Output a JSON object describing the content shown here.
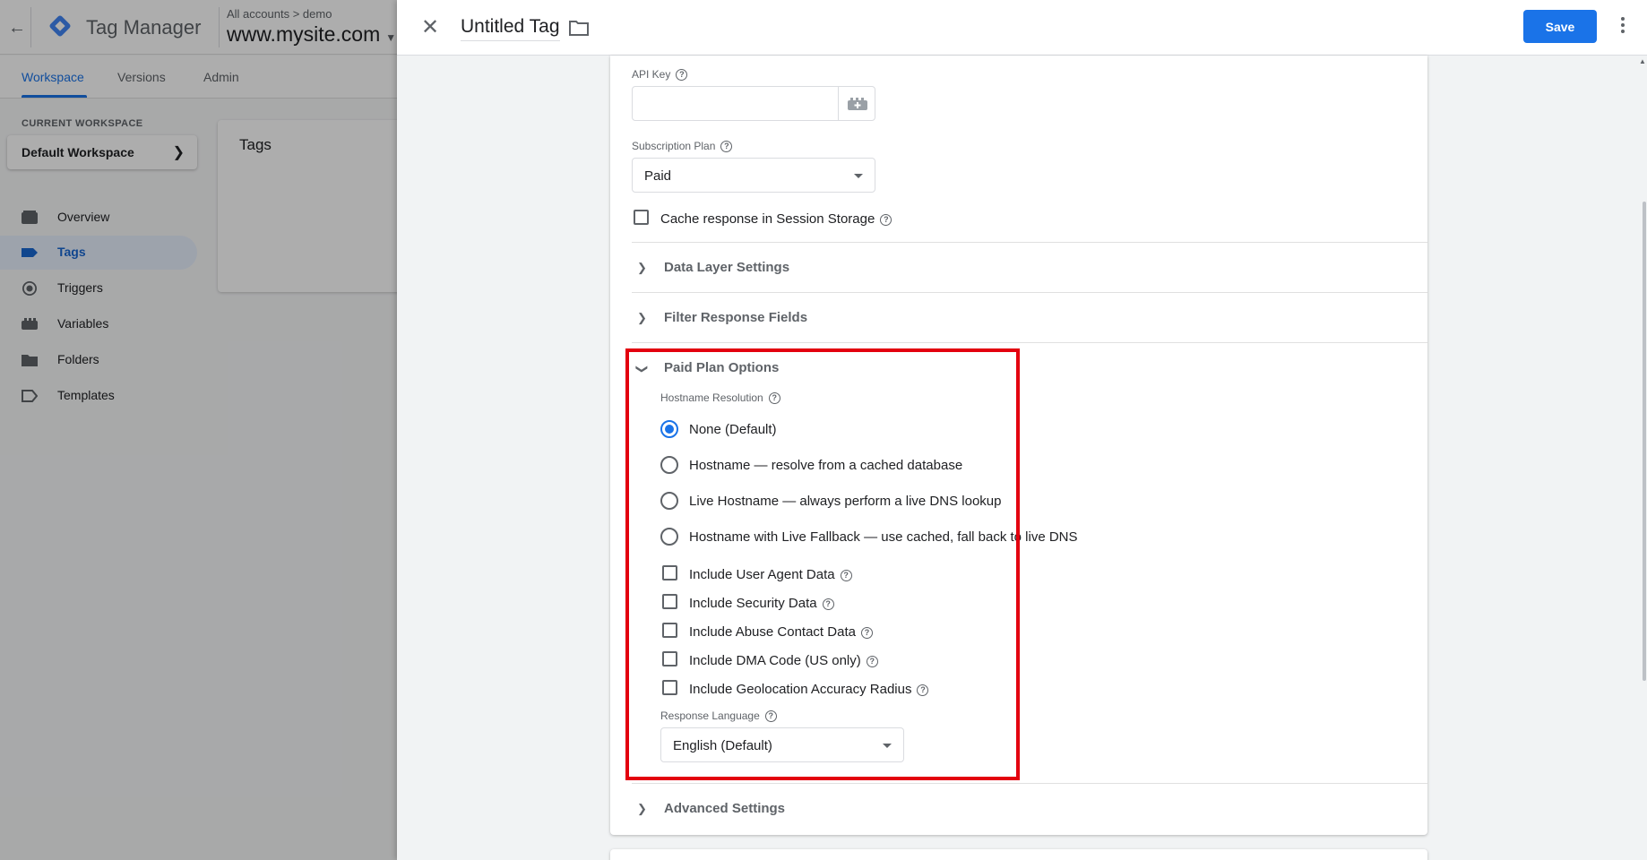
{
  "app": {
    "title": "Tag Manager",
    "breadcrumb": "All accounts > demo",
    "container": "www.mysite.com",
    "tabs": [
      "Workspace",
      "Versions",
      "Admin"
    ],
    "current_workspace_label": "CURRENT WORKSPACE",
    "workspace_name": "Default Workspace",
    "nav": [
      "Overview",
      "Tags",
      "Triggers",
      "Variables",
      "Folders",
      "Templates"
    ],
    "tags_card_title": "Tags"
  },
  "panel": {
    "tag_title": "Untitled Tag",
    "save_label": "Save"
  },
  "form": {
    "api_key_label": "API Key",
    "api_key_value": "",
    "subscription_label": "Subscription Plan",
    "subscription_value": "Paid",
    "cache_label": "Cache response in Session Storage",
    "sections": {
      "data_layer": "Data Layer Settings",
      "filter_fields": "Filter Response Fields",
      "paid_plan": "Paid Plan Options",
      "advanced": "Advanced Settings"
    },
    "hostname_label": "Hostname Resolution",
    "hostname_options": [
      "None (Default)",
      "Hostname — resolve from a cached database",
      "Live Hostname — always perform a live DNS lookup",
      "Hostname with Live Fallback — use cached, fall back to live DNS"
    ],
    "hostname_selected": 0,
    "include_options": [
      "Include User Agent Data",
      "Include Security Data",
      "Include Abuse Contact Data",
      "Include DMA Code (US only)",
      "Include Geolocation Accuracy Radius"
    ],
    "language_label": "Response Language",
    "language_value": "English (Default)"
  },
  "colors": {
    "accent": "#1a73e8",
    "highlight": "#e3000f"
  }
}
